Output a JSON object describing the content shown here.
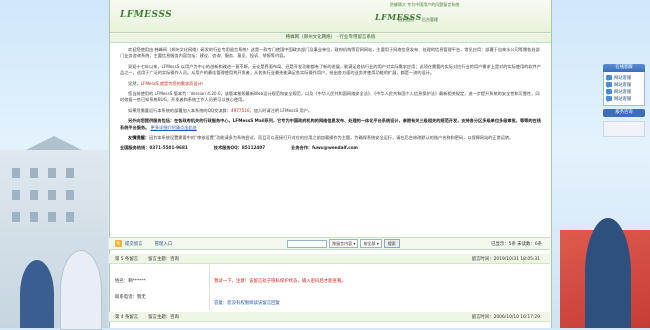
{
  "banner": {
    "logo": "LFMESSS",
    "logo_right": "LFMESSS",
    "tagline": "防御情大 专为中国用户的问题留言系统",
    "link_home": "回到首页",
    "link_admin": "后台管理"
  },
  "breadcrumb": "韩峰网（郑州文化网络）  ·  行业专用留言系统",
  "content": {
    "p1": "欢迎您使用由 韩峰网（郑州文化网络）研发的行业专用留言系统！这是一款专门使国中国政务部门及事业单位，政府机构等官网网站，主要用于网络信息发布、处理的信息管理平台，常见应用：部署于自来水公司等需各处部门业务咨询系统，主要信息服务内容包括：建议、咨询、服务、意见、投诉、举报等内容。",
    "p2": "双迎十七年以来，LFMessS 以用户为中心的创新和改进一直不断，无论是界面布局、还是开发功能都有了新的进展，能满足各执行业的用户对实际需求应用；这项在需要的实际对应行业的用户需求上是对的实际使用的软件产品之一，适用于广泛的实际操作人员。从用户的最佳管理使用到开发者，从各执行业最先能满足各实际操作用户，给出各方面的业务并使用功能的扩展，都是一流的设计。",
    "p3_lead": "显然，",
    "p3_hl": "LFMessS 就是为您的需求而设计！",
    "p4": "您当前使用的 LFMessS 版本为：Version 4.20.0，该版本按照最新Web设计规范和安全规范，以及《中华人民共和国网络安全法》、《中华人民共和国个人信息保护法》最新相关规定，进一步提升系统的安全性和可靠性，同时修复一些已知系统BUG，开发者和系统工作人员更可以放心使用。",
    "p5_prefix": "如果您需要运行本系统的部署加入本系统的QQ交流群：",
    "p5_group": "4977516",
    "p5_suffix": "，加入时请注明 LFMessS 用户。",
    "p6": "另外向您提供服务包括：在各政府机关的行政服务中心，LFMessS Mail系列，它专为中国政府机构的网络信息发布、处理的一体化平台系统设计，参照有关三级相关的规范开发，支持各分区多级单位多级审批，等等的在线系统平台服务。",
    "p6_link": "更多详细介绍请点击此处",
    "p7_prefix": "友情提醒：",
    "p7": "因为本系统设置需要中的“审核设置”功能请多为系统尝试，而且可以直接打开对应的应用之前加载操作为主题。为确保系统安全运行，请在后台修改默认的账户名称和密码，以保障网站的正常运转。",
    "phone_label": "全国服务热线：",
    "phone": "0371-5501-9681",
    "qq_label": "技术服务QQ：",
    "qq": "85112407",
    "email_label": "业务合作：",
    "email": "fuwu@wendalf.com"
  },
  "toolbar": {
    "post_label": "提交留言",
    "admin_label": "管理入口",
    "search_placeholder": "",
    "select1": "按留言内容",
    "select2": "按全部",
    "search_btn": "搜索",
    "stats": "已显示：5条  未读数：6条"
  },
  "entries": [
    {
      "no": "第 5 条留言",
      "topic": "留言主题：咨询",
      "time": "留言时间：2019/10/31 18:05:31",
      "author_label": "姓名：",
      "author": "啊******",
      "contact_label": "联系电话：",
      "contact": "暂无",
      "message": "我试一下。注意！该留言处于隐私保护状态，输入密码后才能查看。"
    },
    {
      "no": "第 4 条留言",
      "topic": "留言主题：咨询",
      "time": "留言时间：2006/10/10 16:17:29",
      "reply": "答复：您没有权限阅读该留言回复"
    }
  ],
  "sidebar": {
    "title": "在线客服",
    "items": [
      "网站客服",
      "网站客服",
      "网站客服",
      "网站客服"
    ],
    "service_btn": "服务咨询"
  },
  "colors": {
    "accent_green": "#3e7d33",
    "link_blue": "#1d4fb8",
    "alert_red": "#d8261a",
    "sidebar_blue": "#3b6db8"
  }
}
